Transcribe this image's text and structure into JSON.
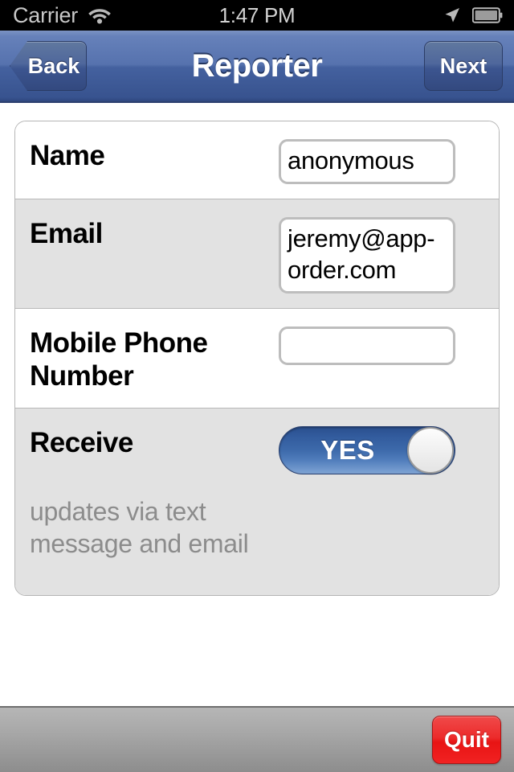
{
  "status_bar": {
    "carrier": "Carrier",
    "wifi_icon": "wifi-icon",
    "time": "1:47 PM",
    "location_icon": "location-arrow-icon",
    "battery_icon": "battery-icon"
  },
  "nav_bar": {
    "back_label": "Back",
    "title": "Reporter",
    "next_label": "Next",
    "accent_color": "#44619f"
  },
  "form": {
    "rows": [
      {
        "label": "Name",
        "value": "anonymous",
        "placeholder": "",
        "type": "text"
      },
      {
        "label": "Email",
        "value": "jeremy@app-order.com",
        "placeholder": "",
        "type": "text"
      },
      {
        "label": "Mobile Phone Number",
        "value": "",
        "placeholder": "",
        "type": "text"
      },
      {
        "label": "Receive",
        "value": "YES",
        "type": "toggle",
        "toggle_on": true,
        "toggle_color": "#3d6aab"
      }
    ],
    "hint": "updates via text message and email",
    "hint_color": "#8c8c8c"
  },
  "toolbar": {
    "quit_label": "Quit",
    "quit_color": "#e81414"
  }
}
